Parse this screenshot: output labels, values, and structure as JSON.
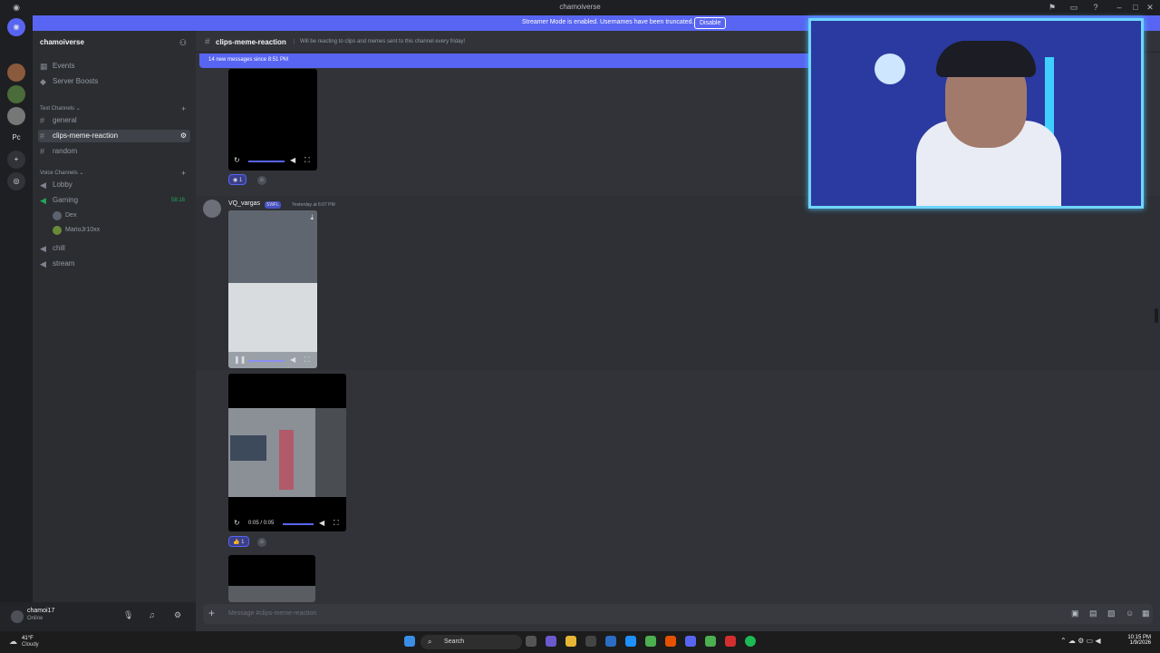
{
  "window": {
    "title": "chamoiverse"
  },
  "banner": {
    "text": "Streamer Mode is enabled. Usernames have been truncated.",
    "button": "Disable"
  },
  "servers": {
    "home_label": "Pc"
  },
  "server": {
    "name": "chamoiverse",
    "top_items": [
      {
        "label": "Events"
      },
      {
        "label": "Server Boosts"
      }
    ],
    "text_category": "Text Channels",
    "text_channels": [
      {
        "label": "general"
      },
      {
        "label": "clips-meme-reaction"
      },
      {
        "label": "random"
      }
    ],
    "voice_category": "Voice Channels",
    "voice_channels": [
      {
        "label": "Lobby"
      },
      {
        "label": "Gaming",
        "timer": "58:16"
      },
      {
        "label": "chill"
      },
      {
        "label": "stream"
      }
    ],
    "voice_users": [
      {
        "name": "Dex"
      },
      {
        "name": "MarioJr10xx"
      }
    ]
  },
  "user": {
    "name": "chamoi17",
    "status": "Online"
  },
  "channel": {
    "name": "clips-meme-reaction",
    "topic": "Will be reacting to clips and memes sent to this channel every friday!",
    "new_messages": "14 new messages since 8:51 PM"
  },
  "messages": [
    {
      "reaction_count": "1"
    },
    {
      "author": "VQ_vargas",
      "badge": "SWFL",
      "timestamp": "Yesterday at 6:07 PM"
    },
    {
      "time": "0:05 / 0:05",
      "reaction_count": "1"
    }
  ],
  "composer": {
    "placeholder": "Message #clips-meme-reaction"
  },
  "taskbar": {
    "weather_temp": "41°F",
    "weather_desc": "Cloudy",
    "search": "Search",
    "time": "10:15 PM",
    "date": "1/9/2026"
  },
  "colors": {
    "blurple": "#5865f2",
    "webcam_border": "#6fd6ff"
  }
}
